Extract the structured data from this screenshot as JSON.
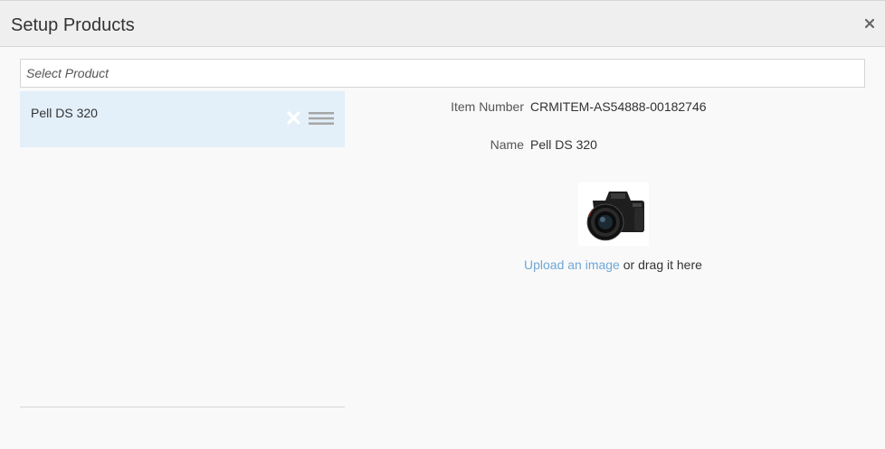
{
  "dialog": {
    "title": "Setup Products",
    "close_label": "×"
  },
  "search": {
    "placeholder": "Select Product",
    "value": ""
  },
  "products": [
    {
      "name": "Pell DS 320",
      "selected": true
    }
  ],
  "details": {
    "item_number_label": "Item Number",
    "item_number_value": "CRMITEM-AS54888-00182746",
    "name_label": "Name",
    "name_value": "Pell DS 320"
  },
  "image": {
    "icon": "camera-photo",
    "upload_link": "Upload an image",
    "upload_suffix": " or drag it here"
  },
  "colors": {
    "header_bg": "#efefef",
    "selected_row_bg": "#e3eff9",
    "link": "#6fa7d6"
  }
}
